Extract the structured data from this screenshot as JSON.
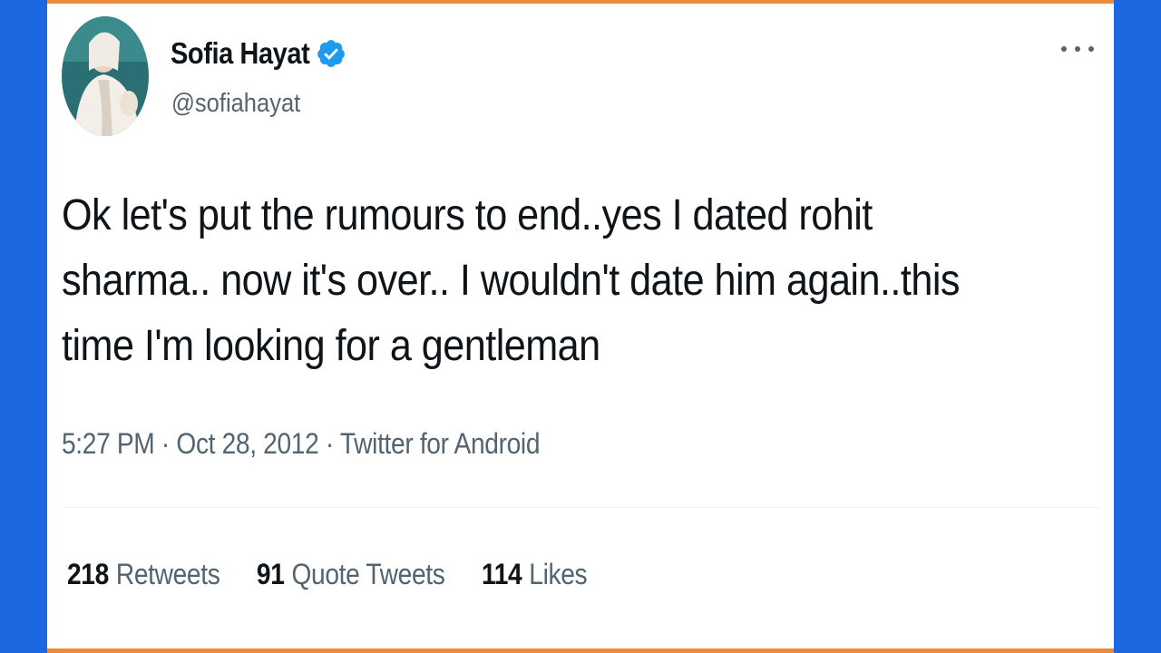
{
  "tweet": {
    "author": {
      "display_name": "Sofia Hayat",
      "handle": "@sofiahayat",
      "verified": true,
      "verified_color": "#1d9bf0"
    },
    "text": "Ok let's put the rumours to end..yes I dated rohit sharma.. now it's over.. I wouldn't date him again..this time I'm looking for a gentleman",
    "meta": {
      "time": "5:27 PM",
      "separator": "·",
      "date": "Oct 28, 2012",
      "source": "Twitter for Android"
    },
    "stats": {
      "retweets": {
        "count": "218",
        "label": "Retweets"
      },
      "quote_tweets": {
        "count": "91",
        "label": "Quote Tweets"
      },
      "likes": {
        "count": "114",
        "label": "Likes"
      }
    },
    "more_icon": "more-horizontal-icon"
  },
  "colors": {
    "background": "#1d67e0",
    "card": "#ffffff",
    "accent_border": "#ee8a3c"
  }
}
